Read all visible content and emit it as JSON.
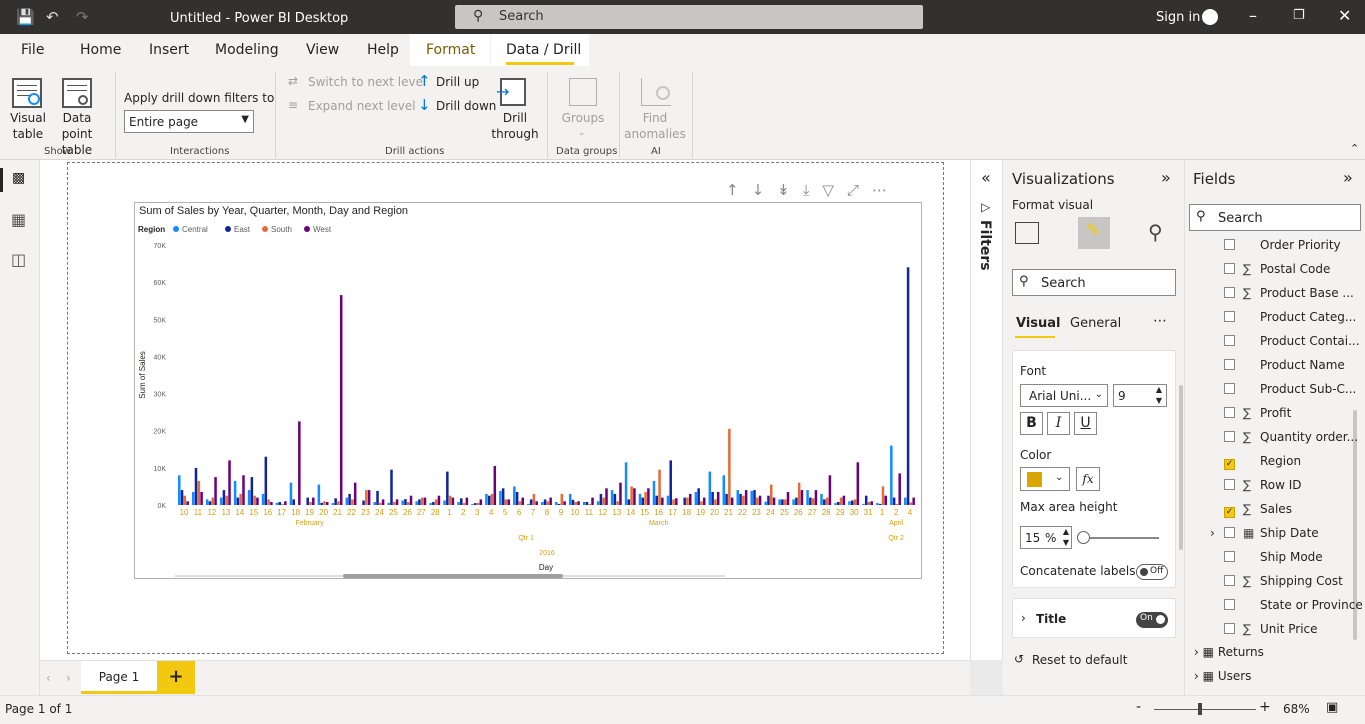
{
  "window": {
    "title": "Untitled - Power BI Desktop",
    "search_placeholder": "Search",
    "sign_in": "Sign in"
  },
  "ribbon_tabs": [
    "File",
    "Home",
    "Insert",
    "Modeling",
    "View",
    "Help",
    "Format",
    "Data / Drill"
  ],
  "ribbon": {
    "visual_table": [
      "Visual",
      "table"
    ],
    "data_point_table": [
      "Data point",
      "table"
    ],
    "show": "Show",
    "apply_filters": "Apply drill down filters to",
    "filter_value": "Entire page",
    "interactions": "Interactions",
    "switch_next": "Switch to next level",
    "expand_next": "Expand next level",
    "drill_up": "Drill up",
    "drill_down": "Drill down",
    "drill_through": [
      "Drill",
      "through"
    ],
    "drill_actions": "Drill actions",
    "groups": "Groups",
    "data_groups": "Data groups",
    "find_anomalies": [
      "Find",
      "anomalies"
    ],
    "ai": "AI"
  },
  "visual": {
    "title": "Sum of Sales by Year, Quarter, Month, Day and Region"
  },
  "chart_data": {
    "type": "bar",
    "title": "Sum of Sales by Year, Quarter, Month, Day and Region",
    "legend_title": "Region",
    "ylabel": "Sum of Sales",
    "xlabel": "Day",
    "yticks": [
      "70K",
      "60K",
      "50K",
      "40K",
      "30K",
      "20K",
      "10K",
      "0K"
    ],
    "ylim": [
      0,
      70000
    ],
    "categories": [
      "10",
      "11",
      "12",
      "13",
      "14",
      "15",
      "16",
      "17",
      "18",
      "19",
      "20",
      "21",
      "22",
      "23",
      "24",
      "25",
      "26",
      "27",
      "28",
      "1",
      "2",
      "3",
      "4",
      "5",
      "6",
      "7",
      "8",
      "9",
      "10",
      "11",
      "12",
      "13",
      "14",
      "15",
      "16",
      "17",
      "18",
      "19",
      "20",
      "21",
      "22",
      "23",
      "24",
      "25",
      "26",
      "27",
      "28",
      "29",
      "30",
      "31",
      "1",
      "2",
      "4"
    ],
    "months": [
      {
        "label": "February",
        "from": 0,
        "to": 18
      },
      {
        "label": "March",
        "from": 19,
        "to": 49
      },
      {
        "label": "April",
        "from": 50,
        "to": 52
      }
    ],
    "quarters": [
      {
        "label": "Qtr 1",
        "from": 0,
        "to": 49
      },
      {
        "label": "Qtr 2",
        "from": 50,
        "to": 52
      }
    ],
    "years": [
      {
        "label": "2016",
        "from": 0,
        "to": 52
      }
    ],
    "series": [
      {
        "name": "Central",
        "color": "#118dff",
        "values": [
          8000,
          3500,
          1500,
          2000,
          6500,
          4000,
          3000,
          600,
          6000,
          0,
          5500,
          500,
          2000,
          0,
          800,
          600,
          1200,
          1000,
          500,
          1200,
          800,
          300,
          3000,
          3800,
          5000,
          300,
          800,
          800,
          3000,
          800,
          1000,
          4000,
          11500,
          3000,
          6500,
          2500,
          0,
          3500,
          9000,
          8000,
          4000,
          3800,
          900,
          1500,
          1500,
          4000,
          3000,
          500,
          1000,
          300,
          500,
          16000,
          2000
        ]
      },
      {
        "name": "East",
        "color": "#12239e",
        "values": [
          4000,
          10000,
          1000,
          4000,
          2000,
          7500,
          13000,
          800,
          1500,
          2000,
          600,
          1800,
          3000,
          1200,
          3800,
          9500,
          1600,
          1500,
          800,
          9000,
          1800,
          500,
          2500,
          4500,
          3500,
          1500,
          1500,
          300,
          1400,
          800,
          3000,
          3000,
          1500,
          2000,
          2500,
          12000,
          2000,
          4500,
          3500,
          3000,
          3000,
          4000,
          2500,
          1500,
          2000,
          2000,
          1500,
          800,
          1200,
          2500,
          300,
          2000,
          64000
        ]
      },
      {
        "name": "South",
        "color": "#e66c37",
        "values": [
          2500,
          6500,
          2000,
          2500,
          3000,
          2500,
          1500,
          300,
          0,
          800,
          1000,
          1000,
          1500,
          4000,
          600,
          800,
          800,
          2000,
          1500,
          2500,
          500,
          600,
          3000,
          1500,
          1000,
          3000,
          1000,
          3000,
          800,
          300,
          2000,
          1000,
          5000,
          3500,
          9500,
          1500,
          2000,
          1000,
          1500,
          20500,
          2500,
          2000,
          5500,
          1500,
          6000,
          1800,
          2000,
          2000,
          1500,
          800,
          5000,
          300,
          700
        ]
      },
      {
        "name": "West",
        "color": "#6b007b",
        "values": [
          1000,
          3500,
          7500,
          12000,
          8000,
          2000,
          800,
          1000,
          22500,
          2000,
          800,
          56500,
          6000,
          4000,
          1500,
          1500,
          2500,
          2000,
          2500,
          2000,
          2000,
          1500,
          10500,
          1500,
          2000,
          1000,
          2000,
          1000,
          1000,
          2000,
          4500,
          6000,
          4500,
          4500,
          2000,
          1800,
          3000,
          2000,
          3500,
          2000,
          4000,
          2500,
          2000,
          3500,
          4000,
          4000,
          8000,
          2500,
          11500,
          1000,
          2500,
          8500,
          2000
        ]
      }
    ]
  },
  "filters_label": "Filters",
  "visualizations": {
    "title": "Visualizations",
    "format_visual": "Format visual",
    "search": "Search",
    "tab_visual": "Visual",
    "tab_general": "General",
    "font": "Font",
    "font_family": "Arial Uni...",
    "font_size": "9",
    "bold": "B",
    "italic": "I",
    "underline": "U",
    "color": "Color",
    "fx": "fx",
    "max_area_height": "Max area height",
    "max_area_value": "15",
    "percent": "%",
    "concatenate_labels": "Concatenate labels",
    "off": "Off",
    "title_card": "Title",
    "on": "On",
    "reset": "Reset to default"
  },
  "fields": {
    "title": "Fields",
    "search": "Search",
    "items": [
      {
        "label": "Order Priority",
        "sigma": false,
        "checked": false
      },
      {
        "label": "Postal Code",
        "sigma": true,
        "checked": false
      },
      {
        "label": "Product Base ...",
        "sigma": true,
        "checked": false
      },
      {
        "label": "Product Categ...",
        "sigma": false,
        "checked": false
      },
      {
        "label": "Product Contai...",
        "sigma": false,
        "checked": false
      },
      {
        "label": "Product Name",
        "sigma": false,
        "checked": false
      },
      {
        "label": "Product Sub-C...",
        "sigma": false,
        "checked": false
      },
      {
        "label": "Profit",
        "sigma": true,
        "checked": false
      },
      {
        "label": "Quantity order...",
        "sigma": true,
        "checked": false
      },
      {
        "label": "Region",
        "sigma": false,
        "checked": true
      },
      {
        "label": "Row ID",
        "sigma": true,
        "checked": false
      },
      {
        "label": "Sales",
        "sigma": true,
        "checked": true
      },
      {
        "label": "Ship Date",
        "sigma": false,
        "checked": false,
        "table_icon": true
      },
      {
        "label": "Ship Mode",
        "sigma": false,
        "checked": false
      },
      {
        "label": "Shipping Cost",
        "sigma": true,
        "checked": false
      },
      {
        "label": "State or Province",
        "sigma": false,
        "checked": false
      },
      {
        "label": "Unit Price",
        "sigma": true,
        "checked": false
      }
    ],
    "tables": [
      "Returns",
      "Users"
    ]
  },
  "pages": {
    "page1": "Page 1",
    "add": "+"
  },
  "status": {
    "page_of": "Page 1 of 1",
    "zoom": "68%",
    "minus": "-",
    "plus": "+"
  }
}
